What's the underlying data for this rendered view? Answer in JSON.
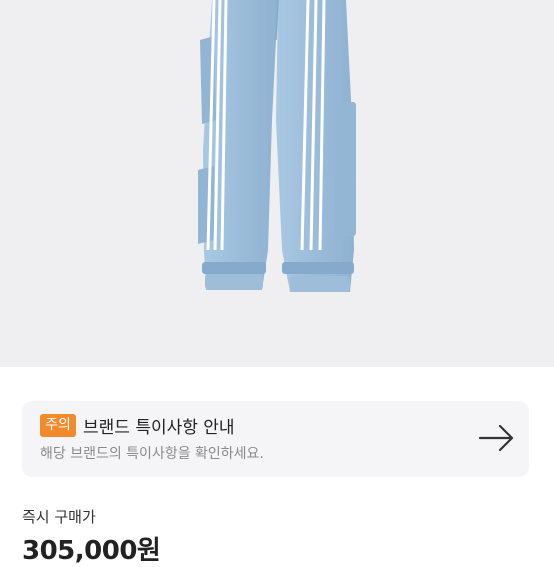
{
  "product": {
    "image_alt": "light blue denim cargo pants with white three stripes",
    "colors": {
      "background": "#efeff1",
      "denim": "#9dbfdc",
      "stripe": "#ffffff"
    }
  },
  "notice": {
    "badge": "주의",
    "title": "브랜드 특이사항 안내",
    "description": "해당 브랜드의 특이사항을 확인하세요.",
    "badge_color": "#f08a2b",
    "arrow_icon": "arrow-right-icon"
  },
  "purchase": {
    "label": "즉시 구매가",
    "price": "305,000원"
  }
}
